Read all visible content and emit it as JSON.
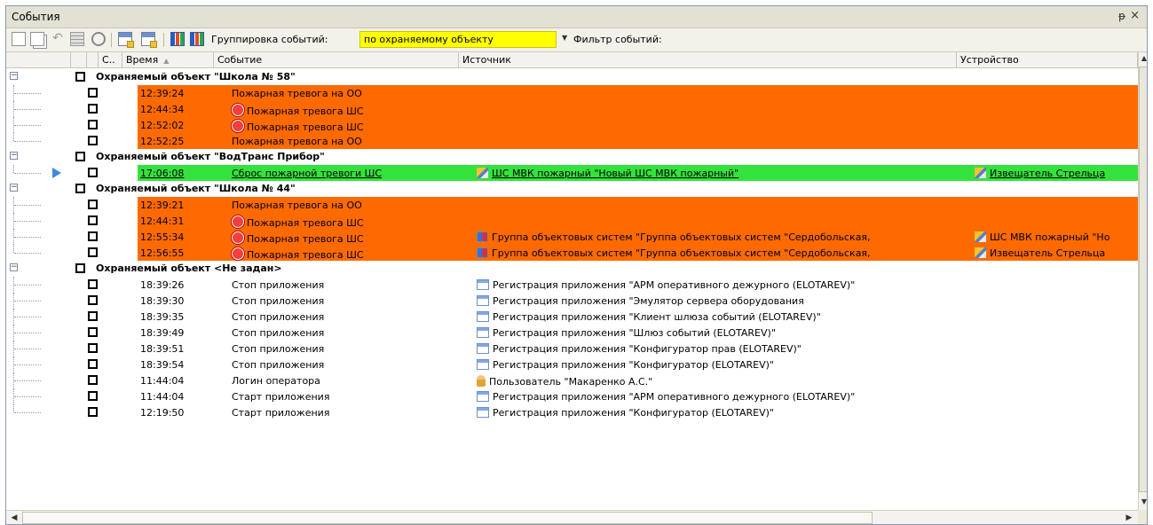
{
  "window": {
    "title": "События",
    "pin_glyph": "ᵽ",
    "close_glyph": "×"
  },
  "toolbar": {
    "grouping_label": "Группировка событий:",
    "grouping_value": "по охраняемому объекту",
    "filter_label": "Фильтр событий:"
  },
  "columns": {
    "c": "С..",
    "time": "Время",
    "event": "Событие",
    "source": "Источник",
    "device": "Устройство"
  },
  "groups": [
    {
      "title": "Охраняемый объект \"Школа № 58\"",
      "rows": [
        {
          "time": "12:39:24",
          "event": "Пожарная тревога на ОО",
          "event_icon": "",
          "source": "",
          "source_icon": "",
          "device": "",
          "device_icon": "",
          "highlight": "orange"
        },
        {
          "time": "12:44:34",
          "event": "Пожарная тревога ШС",
          "event_icon": "fire-icon",
          "source": "",
          "source_icon": "",
          "device": "",
          "device_icon": "",
          "highlight": "orange"
        },
        {
          "time": "12:52:02",
          "event": "Пожарная тревога ШС",
          "event_icon": "fire-icon",
          "source": "",
          "source_icon": "",
          "device": "",
          "device_icon": "",
          "highlight": "orange"
        },
        {
          "time": "12:52:25",
          "event": "Пожарная тревога на ОО",
          "event_icon": "",
          "source": "",
          "source_icon": "",
          "device": "",
          "device_icon": "",
          "highlight": "orange"
        }
      ]
    },
    {
      "title": "Охраняемый объект \"ВодТранс Прибор\"",
      "rows": [
        {
          "time": "17:06:08",
          "event": "Сброс пожарной тревоги ШС",
          "event_icon": "",
          "source": "ШС МВК пожарный \"Новый ШС МВК пожарный\"",
          "source_icon": "sensor-icon",
          "device": "Извещатель Стрельца",
          "device_icon": "sensor-icon",
          "highlight": "green",
          "selected": true
        }
      ]
    },
    {
      "title": "Охраняемый объект \"Школа № 44\"",
      "rows": [
        {
          "time": "12:39:21",
          "event": "Пожарная тревога на ОО",
          "event_icon": "",
          "source": "",
          "source_icon": "",
          "device": "",
          "device_icon": "",
          "highlight": "orange"
        },
        {
          "time": "12:44:31",
          "event": "Пожарная тревога ШС",
          "event_icon": "fire-icon",
          "source": "",
          "source_icon": "",
          "device": "",
          "device_icon": "",
          "highlight": "orange"
        },
        {
          "time": "12:55:34",
          "event": "Пожарная тревога ШС",
          "event_icon": "fire-icon",
          "source": "Группа объектовых систем \"Группа объектовых систем \"Сердобольская,",
          "source_icon": "group-icon",
          "device": "ШС МВК пожарный \"Но",
          "device_icon": "sensor-icon",
          "highlight": "orange"
        },
        {
          "time": "12:56:55",
          "event": "Пожарная тревога ШС",
          "event_icon": "fire-icon",
          "source": "Группа объектовых систем \"Группа объектовых систем \"Сердобольская,",
          "source_icon": "group-icon",
          "device": "Извещатель Стрельца",
          "device_icon": "sensor-icon",
          "highlight": "orange"
        }
      ]
    },
    {
      "title": "Охраняемый объект <Не задан>",
      "rows": [
        {
          "time": "18:39:26",
          "event": "Стоп приложения",
          "event_icon": "",
          "source": "Регистрация приложения \"АРМ оперативного дежурного (ELOTAREV)\"",
          "source_icon": "app-icon",
          "device": "",
          "device_icon": "",
          "highlight": ""
        },
        {
          "time": "18:39:30",
          "event": "Стоп приложения",
          "event_icon": "",
          "source": "Регистрация приложения \"Эмулятор сервера оборудования",
          "source_icon": "app-icon",
          "device": "",
          "device_icon": "",
          "highlight": ""
        },
        {
          "time": "18:39:35",
          "event": "Стоп приложения",
          "event_icon": "",
          "source": "Регистрация приложения \"Клиент шлюза событий (ELOTAREV)\"",
          "source_icon": "app-icon",
          "device": "",
          "device_icon": "",
          "highlight": ""
        },
        {
          "time": "18:39:49",
          "event": "Стоп приложения",
          "event_icon": "",
          "source": "Регистрация приложения \"Шлюз событий (ELOTAREV)\"",
          "source_icon": "app-icon",
          "device": "",
          "device_icon": "",
          "highlight": ""
        },
        {
          "time": "18:39:51",
          "event": "Стоп приложения",
          "event_icon": "",
          "source": "Регистрация приложения \"Конфигуратор прав (ELOTAREV)\"",
          "source_icon": "app-icon",
          "device": "",
          "device_icon": "",
          "highlight": ""
        },
        {
          "time": "18:39:54",
          "event": "Стоп приложения",
          "event_icon": "",
          "source": "Регистрация приложения \"Конфигуратор (ELOTAREV)\"",
          "source_icon": "app-icon",
          "device": "",
          "device_icon": "",
          "highlight": ""
        },
        {
          "time": "11:44:04",
          "event": "Логин оператора",
          "event_icon": "",
          "source": "Пользователь \"Макаренко А.С.\"",
          "source_icon": "user-icon",
          "device": "",
          "device_icon": "",
          "highlight": ""
        },
        {
          "time": "11:44:04",
          "event": "Старт приложения",
          "event_icon": "",
          "source": "Регистрация приложения \"АРМ оперативного дежурного (ELOTAREV)\"",
          "source_icon": "app-icon",
          "device": "",
          "device_icon": "",
          "highlight": ""
        },
        {
          "time": "12:19:50",
          "event": "Старт приложения",
          "event_icon": "",
          "source": "Регистрация приложения \"Конфигуратор (ELOTAREV)\"",
          "source_icon": "app-icon",
          "device": "",
          "device_icon": "",
          "highlight": ""
        }
      ]
    }
  ],
  "colors": {
    "alarm": "#ff6a00",
    "reset": "#33e33c",
    "highlight_select": "#ffff00"
  }
}
